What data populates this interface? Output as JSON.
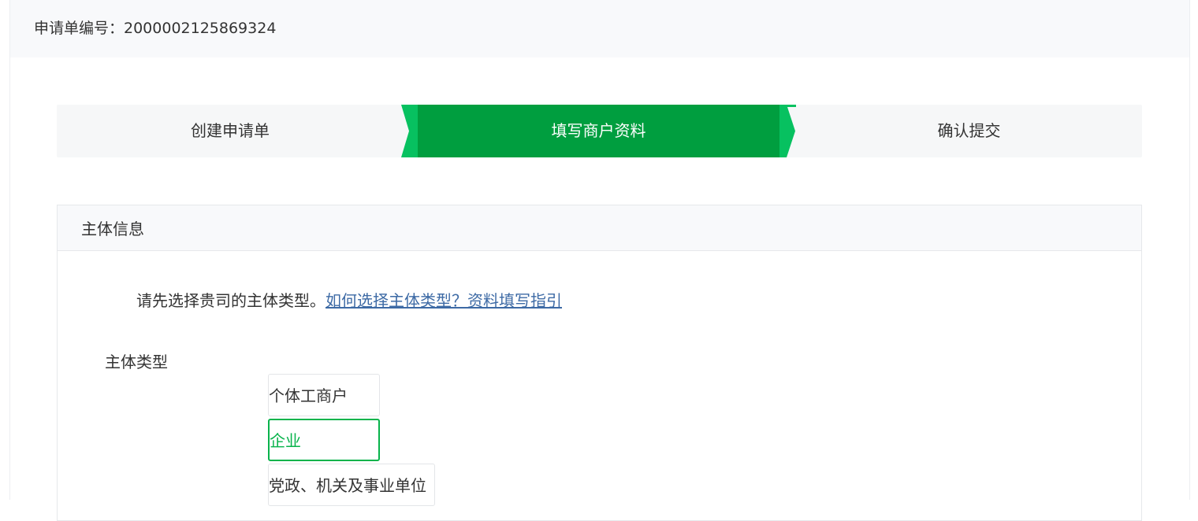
{
  "header": {
    "application_number": "申请单编号：2000002125869324"
  },
  "steps": [
    {
      "label": "创建申请单",
      "state": "done"
    },
    {
      "label": "填写商户资料",
      "state": "active"
    },
    {
      "label": "确认提交",
      "state": "pending"
    }
  ],
  "section": {
    "title": "主体信息",
    "hint_text": "请先选择贵司的主体类型。",
    "hint_link": "如何选择主体类型？资料填写指引",
    "field_label": "主体类型",
    "options": [
      {
        "label": "个体工商户",
        "selected": false
      },
      {
        "label": "企业",
        "selected": true
      },
      {
        "label": "党政、机关及事业单位",
        "selected": false
      }
    ]
  },
  "colors": {
    "step_active": "#009e3f",
    "step_arrow": "#07c160",
    "selected_option": "#07b34b",
    "link": "#3d6aa5"
  },
  "icons": {
    "step_separator": "chevron-right-arrow"
  }
}
